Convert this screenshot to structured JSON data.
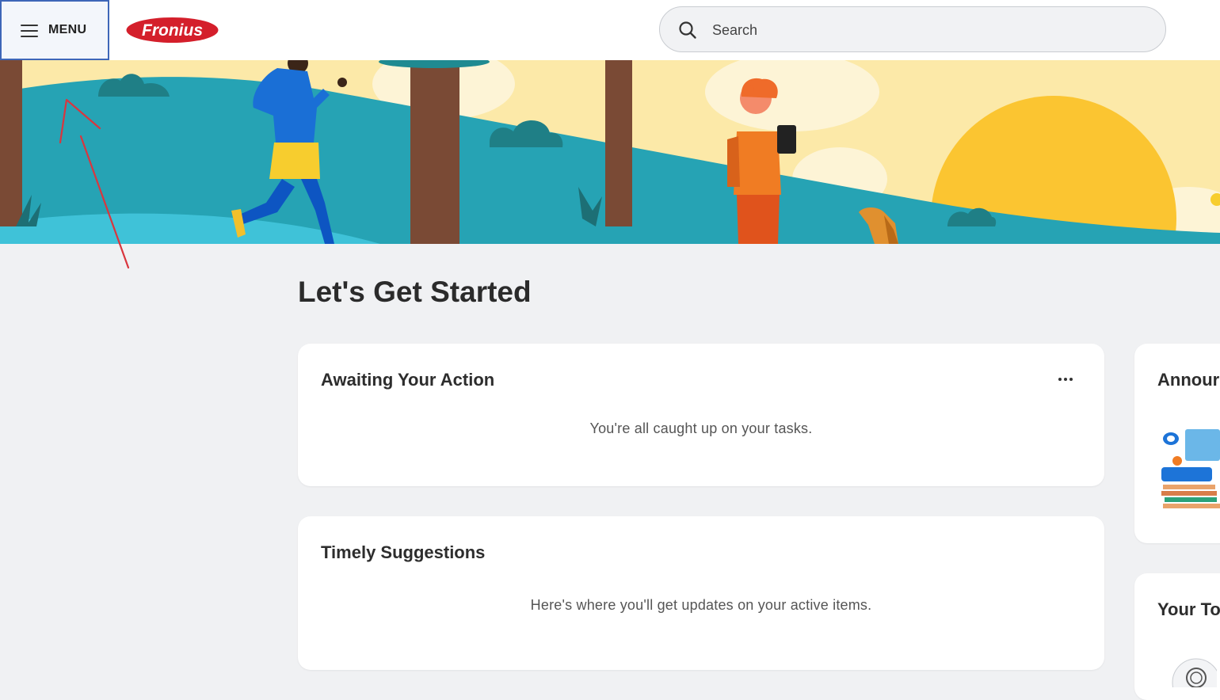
{
  "header": {
    "menu_label": "MENU",
    "logo_text": "Fronius",
    "search": {
      "placeholder": "Search"
    }
  },
  "main": {
    "page_title": "Let's Get Started",
    "cards": [
      {
        "title": "Awaiting Your Action",
        "message": "You're all caught up on your tasks."
      },
      {
        "title": "Timely Suggestions",
        "message": "Here's where you'll get updates on your active items."
      }
    ],
    "side_cards": [
      {
        "title": "Annour"
      },
      {
        "title": "Your To"
      }
    ]
  },
  "colors": {
    "brand_red": "#d41f2b",
    "menu_border": "#3e66b8",
    "page_bg": "#f0f1f3",
    "annotation_red": "#d9363e"
  }
}
